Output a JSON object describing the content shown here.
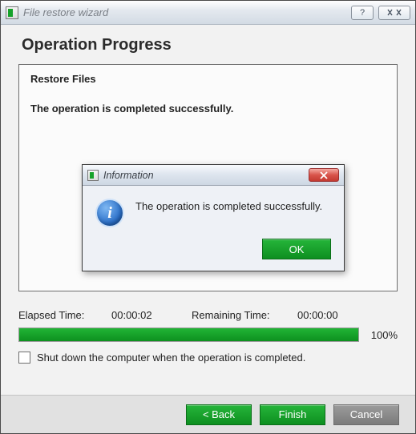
{
  "window": {
    "title": "File restore wizard",
    "help_label": "?",
    "close_glyph": "✕"
  },
  "page": {
    "title": "Operation Progress",
    "panel_heading": "Restore Files",
    "panel_message": "The operation is completed successfully."
  },
  "dialog": {
    "title": "Information",
    "message": "The operation is completed successfully.",
    "ok_label": "OK"
  },
  "status": {
    "elapsed_label": "Elapsed Time:",
    "elapsed_value": "00:00:02",
    "remaining_label": "Remaining Time:",
    "remaining_value": "00:00:00",
    "progress_percent": 100,
    "progress_text": "100%"
  },
  "options": {
    "shutdown_label": "Shut down the computer when the operation is completed.",
    "shutdown_checked": false
  },
  "footer": {
    "back_label": "< Back",
    "finish_label": "Finish",
    "cancel_label": "Cancel"
  }
}
